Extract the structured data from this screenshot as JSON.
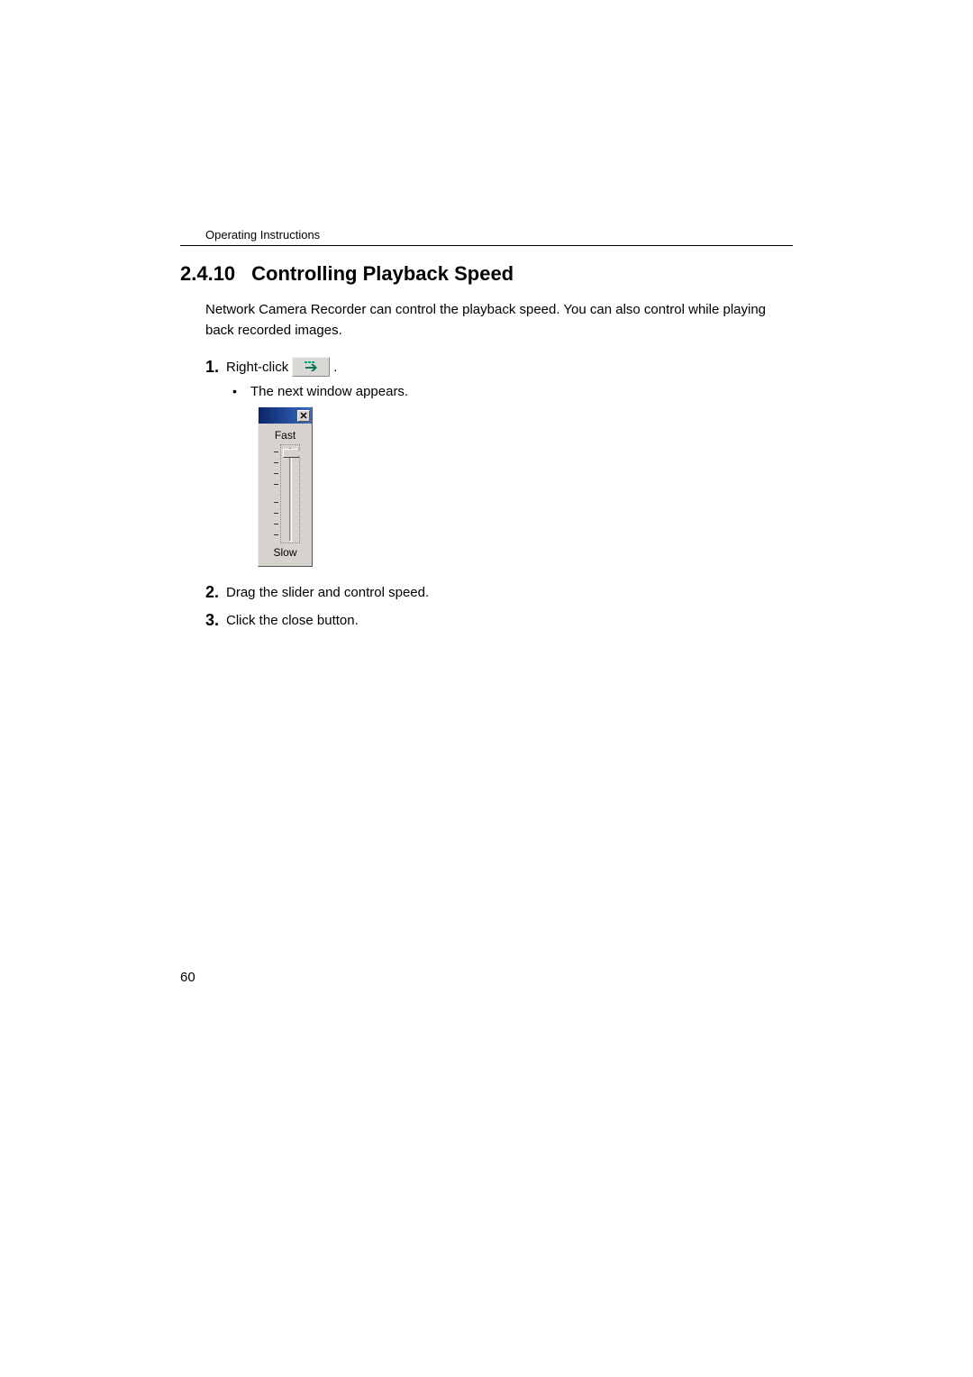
{
  "header": "Operating Instructions",
  "section": {
    "number": "2.4.10",
    "title": "Controlling Playback Speed"
  },
  "intro": "Network Camera Recorder can control the playback speed. You can also control while playing back recorded images.",
  "steps": [
    {
      "num": "1.",
      "text_before": "Right-click ",
      "text_after": " ."
    },
    {
      "num": "2.",
      "text": "Drag the slider and control speed."
    },
    {
      "num": "3.",
      "text": "Click the close button."
    }
  ],
  "sub_bullet": "The next window appears.",
  "slider": {
    "top_label": "Fast",
    "bottom_label": "Slow"
  },
  "page_number": "60"
}
